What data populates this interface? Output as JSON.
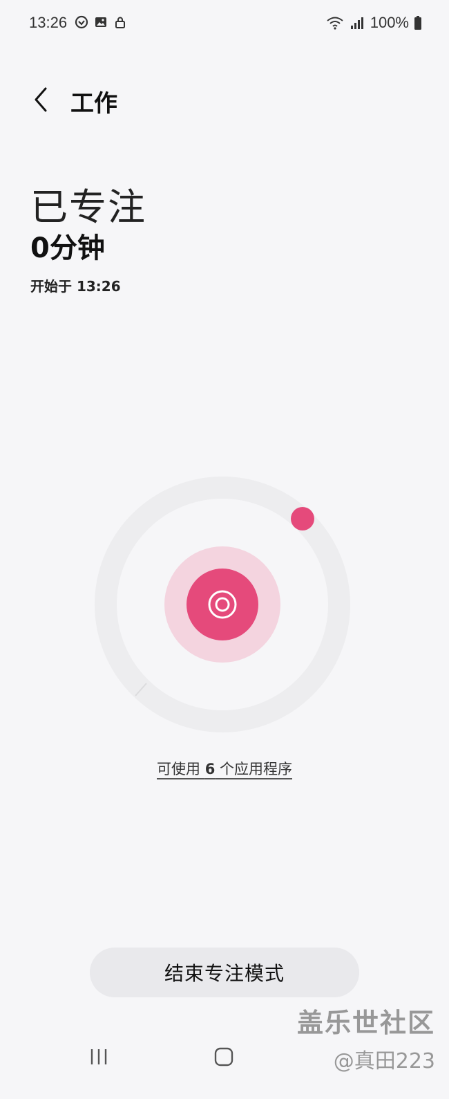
{
  "status_bar": {
    "time": "13:26",
    "battery": "100%",
    "left_icons": [
      "sync-icon",
      "image-icon",
      "lock-icon"
    ],
    "right_icons": [
      "wifi-icon",
      "signal-icon",
      "battery-icon"
    ]
  },
  "header": {
    "title": "工作"
  },
  "focus": {
    "heading": "已专注",
    "duration": "0分钟",
    "start_label": "开始于 13:26"
  },
  "ring": {
    "progress": 0,
    "accent_color": "#e54a7b",
    "inner_glow_color": "#f4d4df",
    "track_color": "#ededef"
  },
  "apps_link": {
    "prefix": "可使用 ",
    "count": "6",
    "suffix": " 个应用程序"
  },
  "end_button": {
    "label": "结束专注模式"
  },
  "watermark": {
    "title": "盖乐世社区",
    "user": "@真田223"
  }
}
